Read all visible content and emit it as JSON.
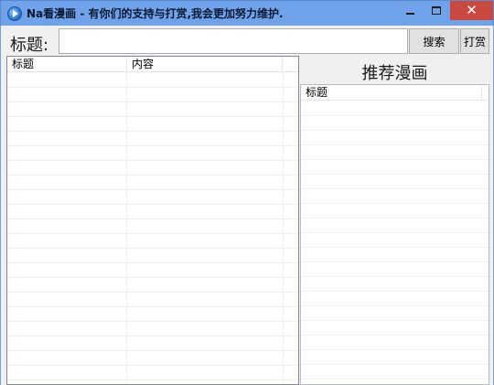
{
  "window": {
    "title": "Na看漫画 - 有你们的支持与打赏,我会更加努力维护.",
    "minimize_icon": "minimize-icon",
    "maximize_icon": "maximize-icon",
    "close_glyph": "✕"
  },
  "search": {
    "label": "标题:",
    "value": "",
    "placeholder": "",
    "search_button": "搜索",
    "donate_button": "打赏"
  },
  "results_list": {
    "columns": [
      "标题",
      "内容"
    ],
    "rows": []
  },
  "recommend": {
    "title": "推荐漫画",
    "columns": [
      "标题"
    ],
    "rows": []
  },
  "colors": {
    "titlebar": "#6fa2e8",
    "close_button": "#c9483f",
    "client_bg": "#f0f0f0"
  }
}
